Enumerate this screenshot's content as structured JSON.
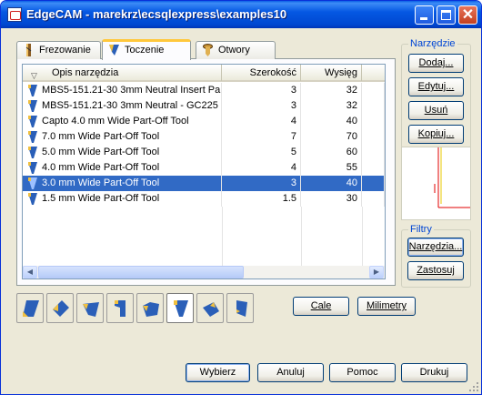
{
  "window": {
    "title": "EdgeCAM - marekrz\\ecsqlexpress\\examples10",
    "minimize_glyph": "",
    "maximize_glyph": "",
    "close_glyph": "✕"
  },
  "tabs": [
    {
      "label": "Frezowanie",
      "icon": "milling-tool-icon",
      "active": false
    },
    {
      "label": "Toczenie",
      "icon": "turning-tool-icon",
      "active": true
    },
    {
      "label": "Otwory",
      "icon": "drilling-tool-icon",
      "active": false
    }
  ],
  "tool_list": {
    "columns": {
      "name": "Opis narzędzia",
      "width": "Szerokość",
      "reach": "Wysięg"
    },
    "rows": [
      {
        "name": "MBS5-151.21-30 3mm Neutral Insert Part",
        "width": "3",
        "reach": "32",
        "selected": false
      },
      {
        "name": "MBS5-151.21-30 3mm Neutral -  GC225",
        "width": "3",
        "reach": "32",
        "selected": false
      },
      {
        "name": "Capto 4.0 mm Wide Part-Off Tool",
        "width": "4",
        "reach": "40",
        "selected": false
      },
      {
        "name": "7.0 mm Wide Part-Off Tool",
        "width": "7",
        "reach": "70",
        "selected": false
      },
      {
        "name": "5.0 mm Wide Part-Off Tool",
        "width": "5",
        "reach": "60",
        "selected": false
      },
      {
        "name": "4.0 mm Wide Part-Off Tool",
        "width": "4",
        "reach": "55",
        "selected": false
      },
      {
        "name": "3.0 mm Wide Part-Off Tool",
        "width": "3",
        "reach": "40",
        "selected": true
      },
      {
        "name": "1.5 mm Wide Part-Off Tool",
        "width": "1.5",
        "reach": "30",
        "selected": false
      }
    ],
    "scroll_left": "◀",
    "scroll_right": "▶"
  },
  "tool_types": [
    {
      "name": "turning-tool-type-1-icon",
      "pressed": false
    },
    {
      "name": "turning-tool-type-2-icon",
      "pressed": false
    },
    {
      "name": "turning-tool-type-3-icon",
      "pressed": false
    },
    {
      "name": "turning-tool-type-4-icon",
      "pressed": false
    },
    {
      "name": "turning-tool-type-5-icon",
      "pressed": false
    },
    {
      "name": "part-off-tool-icon",
      "pressed": true
    },
    {
      "name": "turning-tool-type-7-icon",
      "pressed": false
    },
    {
      "name": "turning-tool-type-8-icon",
      "pressed": false
    }
  ],
  "units": {
    "cale_label": "Cale",
    "mm_label": "Milimetry"
  },
  "tools_group": {
    "title": "Narzędzie",
    "add_label": "Dodaj...",
    "edit_label": "Edytuj...",
    "delete_label": "Usuń",
    "copy_label": "Kopiuj..."
  },
  "filters_group": {
    "title": "Filtry",
    "tools_label": "Narzędzia...",
    "apply_label": "Zastosuj"
  },
  "footer": {
    "select_label": "Wybierz",
    "cancel_label": "Anuluj",
    "help_label": "Pomoc",
    "print_label": "Drukuj"
  },
  "colors": {
    "title_bar": "#0054e3",
    "selection": "#316ac5",
    "tab_highlight": "#ffc83c",
    "preview_red": "#e00000",
    "preview_yellow": "#e8c800"
  }
}
